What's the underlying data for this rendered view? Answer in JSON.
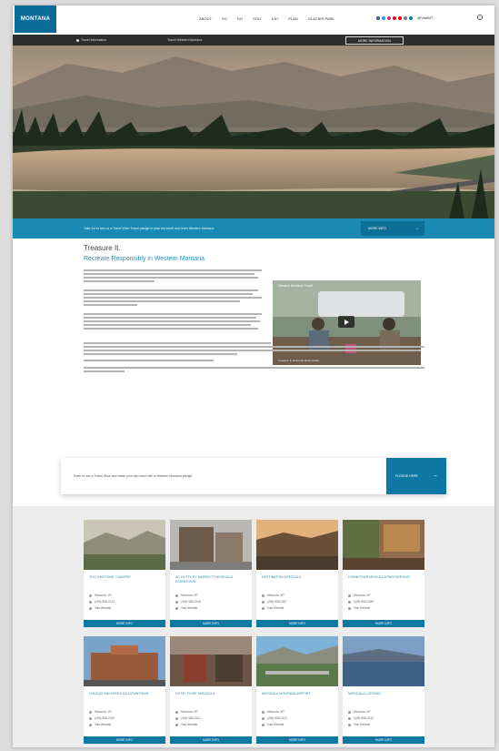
{
  "header": {
    "logo_text": "MONTANA",
    "nav": [
      "About",
      "Go",
      "Do",
      "Stay",
      "Eat",
      "Plan",
      "Glacier Park"
    ],
    "social_handle": "@VisitMT"
  },
  "subbar": {
    "label": "Travel Information",
    "text": "Travel Western Montana",
    "button": "MORE INFORMATION"
  },
  "hero_bar": {
    "text": "Take 1st to see us a Travel Wise Travel pledge to plan trip travel and learn Western Montana",
    "cta": "MORE INFO"
  },
  "article": {
    "title": "Treasure It.",
    "subtitle": "Recreate Responsibly in Western Montana",
    "video_title": "Western Montana Travel",
    "video_caption": "Treasure It. Recreate Responsibly"
  },
  "pledge": {
    "text": "Enter to win a Travel Wise and make your trip count with a Western Montana pledge",
    "cta": "PLEDGE HERE"
  },
  "colors": {
    "accent": "#0d78a4",
    "link": "#2a8db8",
    "dark_bar": "#2e2e2e"
  },
  "cards": [
    {
      "title": "Yellowstone Country",
      "rows": [
        "Missoula, MT",
        "(406) 555-0123",
        "Visit Website"
      ],
      "button": "MORE INFO"
    },
    {
      "title": "AC Hotel by Marriott Missoula Downtown",
      "rows": [
        "Missoula, MT",
        "(406) 555-0145",
        "Visit Website"
      ],
      "button": "MORE INFO"
    },
    {
      "title": "Destination Missoula",
      "rows": [
        "Missoula, MT",
        "(406) 555-0167",
        "Visit Website"
      ],
      "button": "MORE INFO"
    },
    {
      "title": "Downtown Missoula Partnership",
      "rows": [
        "Missoula, MT",
        "(406) 555-0188",
        "Visit Website"
      ],
      "button": "MORE INFO"
    },
    {
      "title": "Holiday Inn Missoula Downtown",
      "rows": [
        "Missoula, MT",
        "(406) 555-0199",
        "Visit Website"
      ],
      "button": "MORE INFO"
    },
    {
      "title": "Hotel Fiore Missoula",
      "rows": [
        "Missoula, MT",
        "(406) 555-0111",
        "Visit Website"
      ],
      "button": "MORE INFO"
    },
    {
      "title": "Missoula Montana Airport",
      "rows": [
        "Missoula, MT",
        "(406) 555-0122",
        "Visit Website"
      ],
      "button": "MORE INFO"
    },
    {
      "title": "Missoula Lodging",
      "rows": [
        "Missoula, MT",
        "(406) 555-0133",
        "Visit Website"
      ],
      "button": "MORE INFO"
    }
  ]
}
